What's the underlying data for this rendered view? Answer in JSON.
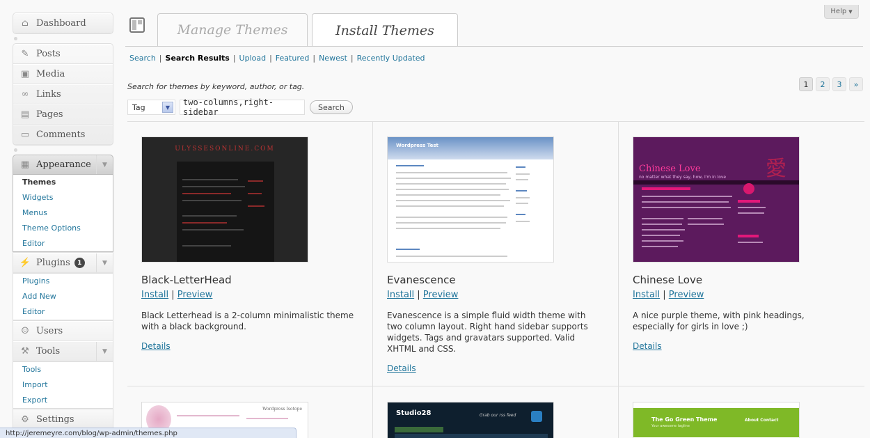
{
  "sidebar": {
    "dashboard": "Dashboard",
    "posts": "Posts",
    "media": "Media",
    "links": "Links",
    "pages": "Pages",
    "comments": "Comments",
    "appearance": {
      "label": "Appearance",
      "items": [
        "Themes",
        "Widgets",
        "Menus",
        "Theme Options",
        "Editor"
      ]
    },
    "plugins": {
      "label": "Plugins",
      "badge": "1",
      "items": [
        "Plugins",
        "Add New",
        "Editor"
      ]
    },
    "users": "Users",
    "tools": {
      "label": "Tools",
      "items": [
        "Tools",
        "Import",
        "Export"
      ]
    },
    "settings": "Settings"
  },
  "tabs": {
    "manage": "Manage Themes",
    "install": "Install Themes"
  },
  "help": "Help",
  "subnav": [
    "Search",
    "Search Results",
    "Upload",
    "Featured",
    "Newest",
    "Recently Updated"
  ],
  "search": {
    "description": "Search for themes by keyword, author, or tag.",
    "type_value": "Tag",
    "query": "two-columns,right-sidebar",
    "button": "Search"
  },
  "pagination": {
    "pages": [
      "1",
      "2",
      "3"
    ],
    "next": "»"
  },
  "themes": [
    {
      "name": "Black-LetterHead",
      "install": "Install",
      "preview": "Preview",
      "description": "Black Letterhead is a 2-column minimalistic theme with a black background.",
      "details": "Details",
      "thumb_title": "ULYSSESONLINE.COM"
    },
    {
      "name": "Evanescence",
      "install": "Install",
      "preview": "Preview",
      "description": "Evanescence is a simple fluid width theme with two column layout. Right hand sidebar supports widgets. Tags and gravatars supported. Valid XHTML and CSS.",
      "details": "Details",
      "thumb_title": "Wordpress Test"
    },
    {
      "name": "Chinese Love",
      "install": "Install",
      "preview": "Preview",
      "description": "A nice purple theme, with pink headings, especially for girls in love ;)",
      "details": "Details",
      "thumb_title": "Chinese Love",
      "thumb_sub": "no matter what they say, how, I'm in love",
      "thumb_glyph": "愛"
    }
  ],
  "row2_thumbs": {
    "pink_title": "Wordpress Isotope",
    "studio_title": "Studio28",
    "studio_grab": "Grab our rss feed",
    "green_title": "The Go Green Theme",
    "green_sub": "Your awesome tagline",
    "green_nav": "About   Contact"
  },
  "statusbar": "http://jeremeyre.com/blog/wp-admin/themes.php"
}
